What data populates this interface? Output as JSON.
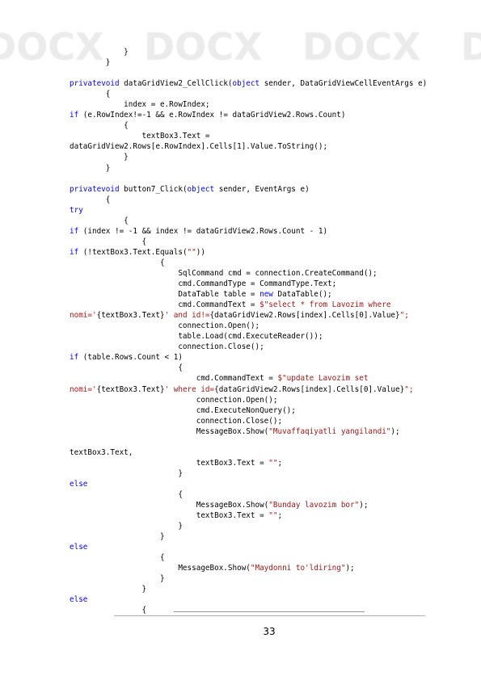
{
  "watermark": {
    "text": "DOCX"
  },
  "code_lines": [
    [
      {
        "t": "            }"
      }
    ],
    [
      {
        "t": "        }"
      }
    ],
    [
      {
        "t": ""
      }
    ],
    [
      {
        "t": "private",
        "c": "kw"
      },
      {
        "t": "void",
        "c": "kw"
      },
      {
        "t": " dataGridView2_CellClick("
      },
      {
        "t": "object",
        "c": "kw"
      },
      {
        "t": " sender, DataGridViewCellEventArgs e)"
      }
    ],
    [
      {
        "t": "        {"
      }
    ],
    [
      {
        "t": "            index = e.RowIndex;"
      }
    ],
    [
      {
        "t": "if",
        "c": "kw"
      },
      {
        "t": " (e.RowIndex!=-1 && e.RowIndex != dataGridView2.Rows.Count)"
      }
    ],
    [
      {
        "t": "            {"
      }
    ],
    [
      {
        "t": "                textBox3.Text ="
      }
    ],
    [
      {
        "t": "dataGridView2.Rows[e.RowIndex].Cells[1].Value.ToString();"
      }
    ],
    [
      {
        "t": "            }"
      }
    ],
    [
      {
        "t": "        }"
      }
    ],
    [
      {
        "t": ""
      }
    ],
    [
      {
        "t": "private",
        "c": "kw"
      },
      {
        "t": "void",
        "c": "kw"
      },
      {
        "t": " button7_Click("
      },
      {
        "t": "object",
        "c": "kw"
      },
      {
        "t": " sender, EventArgs e)"
      }
    ],
    [
      {
        "t": "        {"
      }
    ],
    [
      {
        "t": "try",
        "c": "kw"
      }
    ],
    [
      {
        "t": "            {"
      }
    ],
    [
      {
        "t": "if",
        "c": "kw"
      },
      {
        "t": " (index != -1 && index != dataGridView2.Rows.Count - 1)"
      }
    ],
    [
      {
        "t": "                {"
      }
    ],
    [
      {
        "t": "if",
        "c": "kw"
      },
      {
        "t": " (!textBox3.Text.Equals("
      },
      {
        "t": "\"\"",
        "c": "str"
      },
      {
        "t": "))"
      }
    ],
    [
      {
        "t": "                    {"
      }
    ],
    [
      {
        "t": "                        SqlCommand cmd = connection.CreateCommand();"
      }
    ],
    [
      {
        "t": "                        cmd.CommandType = CommandType.Text;"
      }
    ],
    [
      {
        "t": "                        DataTable table = "
      },
      {
        "t": "new",
        "c": "kw"
      },
      {
        "t": " DataTable();"
      }
    ],
    [
      {
        "t": "                        cmd.CommandText = "
      },
      {
        "t": "$\"select * from Lavozim where",
        "c": "str"
      }
    ],
    [
      {
        "t": "nomi='",
        "c": "str"
      },
      {
        "t": "{textBox3.Text}"
      },
      {
        "t": "' and id!=",
        "c": "str"
      },
      {
        "t": "{dataGridView2.Rows[index].Cells[0].Value}"
      },
      {
        "t": "\";",
        "c": "str"
      }
    ],
    [
      {
        "t": "                        connection.Open();"
      }
    ],
    [
      {
        "t": "                        table.Load(cmd.ExecuteReader());"
      }
    ],
    [
      {
        "t": "                        connection.Close();"
      }
    ],
    [
      {
        "t": "if",
        "c": "kw"
      },
      {
        "t": " (table.Rows.Count < 1)"
      }
    ],
    [
      {
        "t": "                        {"
      }
    ],
    [
      {
        "t": "                            cmd.CommandText = "
      },
      {
        "t": "$\"update Lavozim set",
        "c": "str"
      }
    ],
    [
      {
        "t": "nomi='",
        "c": "str"
      },
      {
        "t": "{textBox3.Text}"
      },
      {
        "t": "' where id=",
        "c": "str"
      },
      {
        "t": "{dataGridView2.Rows[index].Cells[0].Value}"
      },
      {
        "t": "\";",
        "c": "str"
      }
    ],
    [
      {
        "t": "                            connection.Open();"
      }
    ],
    [
      {
        "t": "                            cmd.ExecuteNonQuery();"
      }
    ],
    [
      {
        "t": "                            connection.Close();"
      }
    ],
    [
      {
        "t": "                            MessageBox.Show("
      },
      {
        "t": "\"Muvaffaqiyatli yangilandi\"",
        "c": "str"
      },
      {
        "t": ");"
      }
    ],
    [
      {
        "t": ""
      }
    ],
    [
      {
        "t": "textBox3.Text,"
      }
    ],
    [
      {
        "t": "                            textBox3.Text = "
      },
      {
        "t": "\"\"",
        "c": "str"
      },
      {
        "t": ";"
      }
    ],
    [
      {
        "t": "                        }"
      }
    ],
    [
      {
        "t": "else",
        "c": "kw"
      }
    ],
    [
      {
        "t": "                        {"
      }
    ],
    [
      {
        "t": "                            MessageBox.Show("
      },
      {
        "t": "\"Bunday lavozim bor\"",
        "c": "str"
      },
      {
        "t": ");"
      }
    ],
    [
      {
        "t": "                            textBox3.Text = "
      },
      {
        "t": "\"\"",
        "c": "str"
      },
      {
        "t": ";"
      }
    ],
    [
      {
        "t": "                        }"
      }
    ],
    [
      {
        "t": "                    }"
      }
    ],
    [
      {
        "t": "else",
        "c": "kw"
      }
    ],
    [
      {
        "t": "                    {"
      }
    ],
    [
      {
        "t": "                        MessageBox.Show("
      },
      {
        "t": "\"Maydonni to'ldiring\"",
        "c": "str"
      },
      {
        "t": ");"
      }
    ],
    [
      {
        "t": "                    }"
      }
    ],
    [
      {
        "t": "                }"
      }
    ],
    [
      {
        "t": "else",
        "c": "kw"
      }
    ],
    [
      {
        "t": "                {"
      }
    ]
  ],
  "footer": {
    "page_number": "33"
  }
}
